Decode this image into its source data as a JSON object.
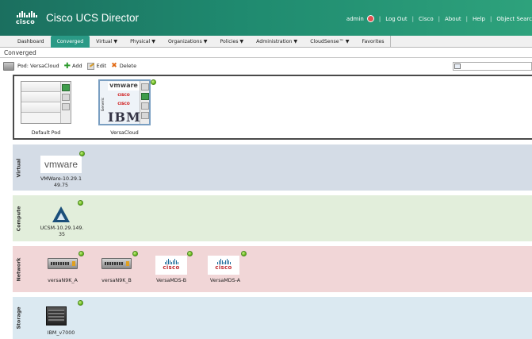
{
  "header": {
    "logo_text": "cisco",
    "app_title": "Cisco UCS Director",
    "user": "admin",
    "links": [
      "Log Out",
      "Cisco",
      "About",
      "Help",
      "Object Searc"
    ]
  },
  "nav": {
    "tabs": [
      {
        "label": "Dashboard"
      },
      {
        "label": "Converged"
      },
      {
        "label": "Virtual ▼"
      },
      {
        "label": "Physical ▼"
      },
      {
        "label": "Organizations ▼"
      },
      {
        "label": "Policies ▼"
      },
      {
        "label": "Administration ▼"
      },
      {
        "label": "CloudSense™ ▼"
      },
      {
        "label": "Favorites"
      }
    ],
    "active": "Converged"
  },
  "page": {
    "title": "Converged"
  },
  "toolbar": {
    "pod_label": "Pod: VersaCloud",
    "add_label": "Add",
    "edit_label": "Edit",
    "delete_label": "Delete",
    "search_placeholder": ""
  },
  "pods": [
    {
      "name": "Default Pod"
    },
    {
      "name": "VersaCloud",
      "side_label": "Generic",
      "vendor_text": "vmware",
      "brand": "IBM",
      "mini_brand": "CISCO"
    }
  ],
  "lanes": {
    "virtual": {
      "label": "Virtual",
      "items": [
        {
          "name": "VMWare-10.29.1\n49.75",
          "logo": "vmware"
        }
      ]
    },
    "compute": {
      "label": "Compute",
      "items": [
        {
          "name": "UCSM-10.29.149.\n35"
        }
      ]
    },
    "network": {
      "label": "Network",
      "items": [
        {
          "name": "versaN9K_A"
        },
        {
          "name": "versaN9K_B"
        },
        {
          "name": "VersaMDS-B",
          "logo": "cisco"
        },
        {
          "name": "VersaMDS-A",
          "logo": "cisco"
        }
      ]
    },
    "storage": {
      "label": "Storage",
      "items": [
        {
          "name": "IBM_v7000"
        }
      ]
    }
  },
  "colors": {
    "header_start": "#1b6f5f",
    "header_end": "#2ea27c",
    "active_tab": "#2a9a86",
    "lane_virtual": "#d4dce6",
    "lane_compute": "#e2eedb",
    "lane_network": "#f1d6d7",
    "lane_storage": "#dbe9f1",
    "status_ok": "#6cbb1f"
  }
}
